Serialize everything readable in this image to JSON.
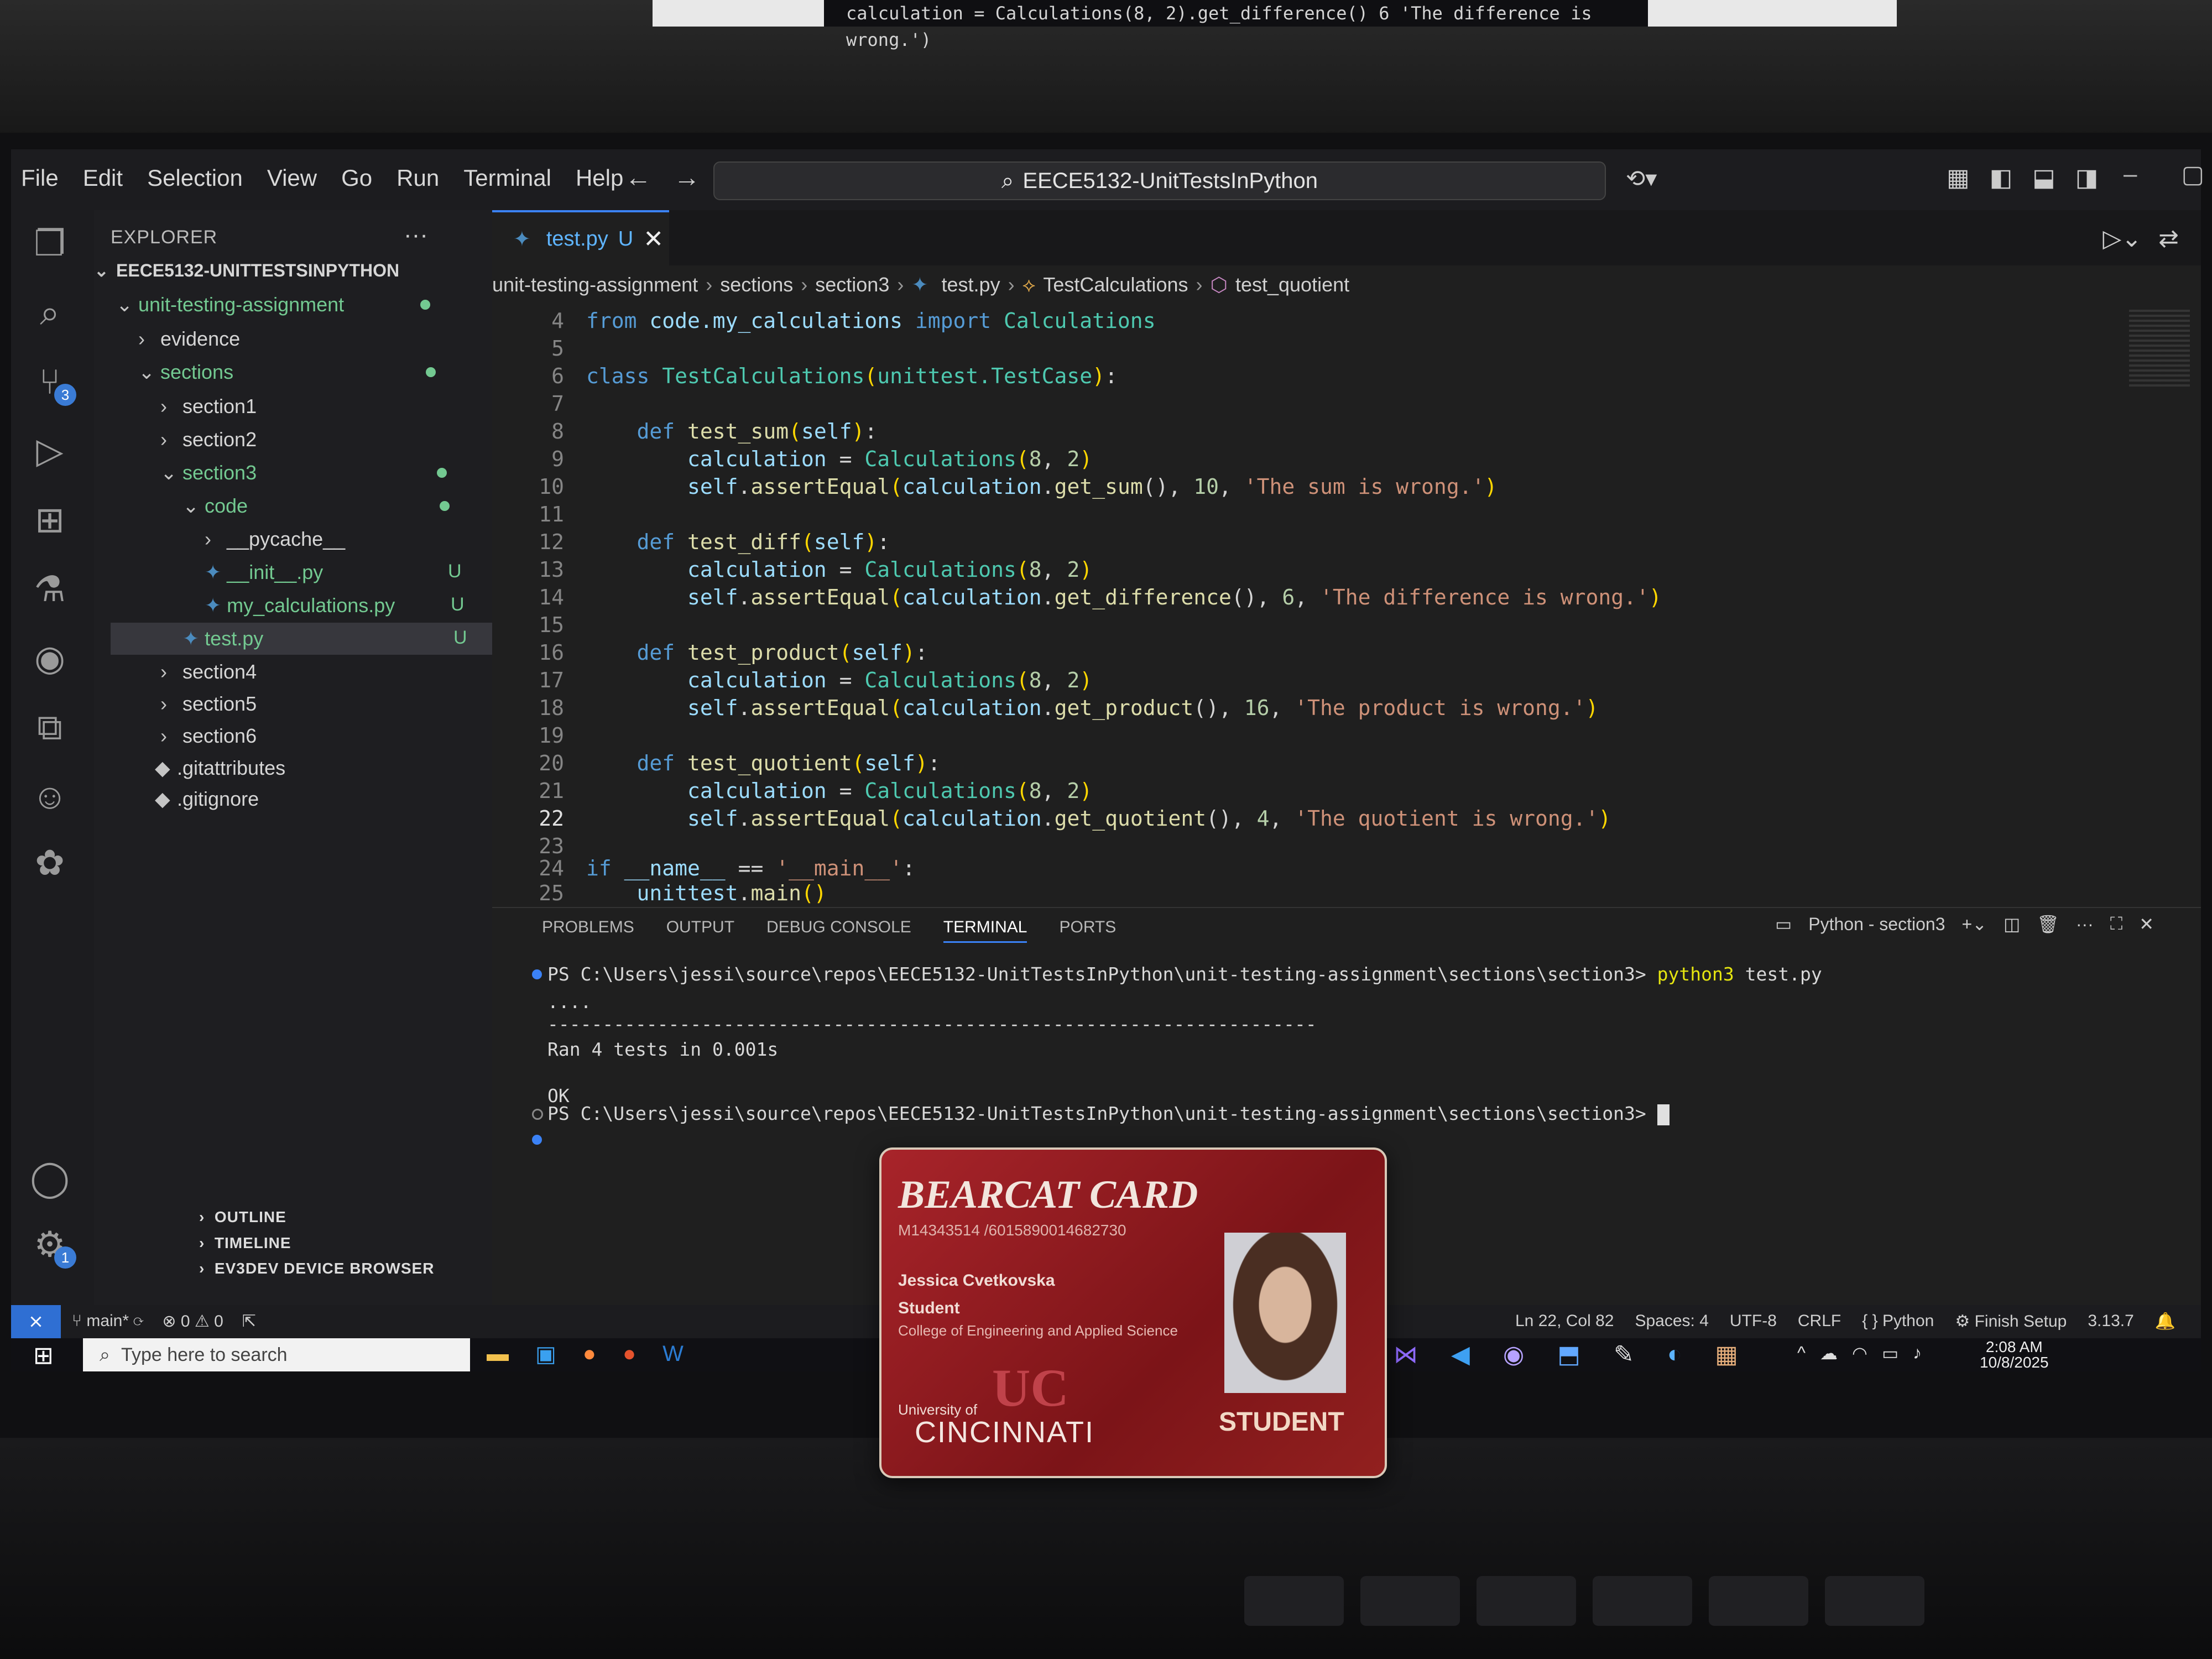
{
  "top_monitor": {
    "code_snippet": "calculation = Calculations(8, 2).get_difference()  6  'The difference is wrong.')"
  },
  "menu": [
    "File",
    "Edit",
    "Selection",
    "View",
    "Go",
    "Run",
    "Terminal",
    "Help"
  ],
  "search": {
    "text": "EECE5132-UnitTestsInPython"
  },
  "explorer": {
    "title": "EXPLORER",
    "root": "EECE5132-UNITTESTSINPYTHON",
    "items": [
      {
        "label": "unit-testing-assignment",
        "depth": 1,
        "open": true,
        "status": "dot"
      },
      {
        "label": "evidence",
        "depth": 2,
        "open": false
      },
      {
        "label": "sections",
        "depth": 2,
        "open": true,
        "status": "dot"
      },
      {
        "label": "section1",
        "depth": 3,
        "open": false
      },
      {
        "label": "section2",
        "depth": 3,
        "open": false
      },
      {
        "label": "section3",
        "depth": 3,
        "open": true,
        "status": "dot"
      },
      {
        "label": "code",
        "depth": 4,
        "open": true,
        "status": "dot"
      },
      {
        "label": "__pycache__",
        "depth": 5,
        "open": false
      },
      {
        "label": "__init__.py",
        "depth": 5,
        "file": "py",
        "status": "U"
      },
      {
        "label": "my_calculations.py",
        "depth": 5,
        "file": "py",
        "status": "U"
      },
      {
        "label": "test.py",
        "depth": 4,
        "file": "py",
        "status": "U",
        "selected": true
      },
      {
        "label": "section4",
        "depth": 3,
        "open": false
      },
      {
        "label": "section5",
        "depth": 3,
        "open": false
      },
      {
        "label": "section6",
        "depth": 3,
        "open": false
      },
      {
        "label": ".gitattributes",
        "depth": 2,
        "file": "git"
      },
      {
        "label": ".gitignore",
        "depth": 2,
        "file": "git"
      }
    ],
    "bottom": [
      "OUTLINE",
      "TIMELINE",
      "EV3DEV DEVICE BROWSER"
    ]
  },
  "editor": {
    "tab": {
      "label": "test.py",
      "status": "U"
    },
    "breadcrumb": [
      "unit-testing-assignment",
      "sections",
      "section3",
      "test.py",
      "TestCalculations",
      "test_quotient"
    ],
    "current_line": 22
  },
  "panel": {
    "tabs": [
      "PROBLEMS",
      "OUTPUT",
      "DEBUG CONSOLE",
      "TERMINAL",
      "PORTS"
    ],
    "active_tab": "TERMINAL",
    "terminal_label": "Python - section3",
    "prompt": "PS C:\\Users\\jessi\\source\\repos\\EECE5132-UnitTestsInPython\\unit-testing-assignment\\sections\\section3>",
    "command": "python3",
    "arg": "test.py",
    "dots": "....",
    "rule": "----------------------------------------------------------------------",
    "ran": "Ran 4 tests in 0.001s",
    "ok": "OK"
  },
  "statusbar": {
    "branch": "main*",
    "problems": "⊗ 0 ⚠ 0",
    "position": "Ln 22, Col 82",
    "spaces": "Spaces: 4",
    "encoding": "UTF-8",
    "eol": "CRLF",
    "language": "Python",
    "setup": "Finish Setup",
    "version": "3.13.7"
  },
  "taskbar": {
    "search_placeholder": "Type here to search",
    "time": "2:08 AM",
    "date": "10/8/2025"
  },
  "card": {
    "title": "BEARCAT CARD",
    "number": "M14343514 /6015890014682730",
    "name": "Jessica Cvetkovska",
    "role": "Student",
    "college": "College of Engineering and Applied Science",
    "university_prefix": "University of",
    "university": "CINCINNATI",
    "badge": "STUDENT"
  },
  "colors": {
    "accent": "#3b82f6",
    "git_untracked": "#73c991",
    "card_red": "#a8242a"
  },
  "icons": [
    "explorer-icon",
    "search-icon",
    "source-control-icon",
    "run-debug-icon",
    "extensions-icon",
    "testing-icon",
    "github-icon",
    "account-icon",
    "settings-icon"
  ]
}
